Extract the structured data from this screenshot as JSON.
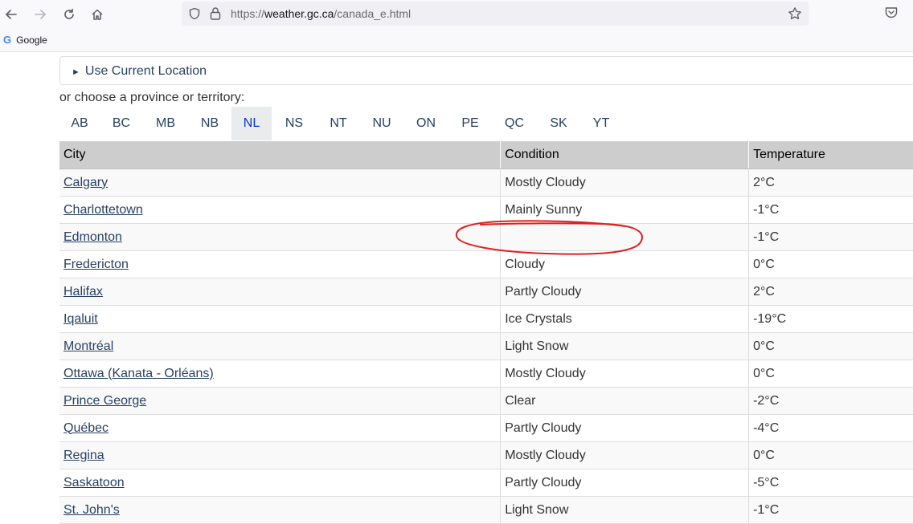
{
  "browser": {
    "url": "https://weather.gc.ca/canada_e.html",
    "url_host": "weather.gc.ca",
    "url_prefix": "https://",
    "url_path": "/canada_e.html",
    "bookmark_label": "Google",
    "bookmark_icon": "G"
  },
  "page": {
    "location_summary": "Use Current Location",
    "choose_text": "or choose a province or territory:",
    "provinces": [
      "AB",
      "BC",
      "MB",
      "NB",
      "NL",
      "NS",
      "NT",
      "NU",
      "ON",
      "PE",
      "QC",
      "SK",
      "YT"
    ],
    "active_province": "NL"
  },
  "table": {
    "headers": [
      "City",
      "Condition",
      "Temperature"
    ],
    "rows": [
      {
        "city": "Calgary",
        "condition": "Mostly Cloudy",
        "temperature": "2°C"
      },
      {
        "city": "Charlottetown",
        "condition": "Mainly Sunny",
        "temperature": "-1°C"
      },
      {
        "city": "Edmonton",
        "condition": "",
        "temperature": "-1°C"
      },
      {
        "city": "Fredericton",
        "condition": "Cloudy",
        "temperature": "0°C"
      },
      {
        "city": "Halifax",
        "condition": "Partly Cloudy",
        "temperature": "2°C"
      },
      {
        "city": "Iqaluit",
        "condition": "Ice Crystals",
        "temperature": "-19°C"
      },
      {
        "city": "Montréal",
        "condition": "Light Snow",
        "temperature": "0°C"
      },
      {
        "city": "Ottawa (Kanata - Orléans)",
        "condition": "Mostly Cloudy",
        "temperature": "0°C"
      },
      {
        "city": "Prince George",
        "condition": "Clear",
        "temperature": "-2°C"
      },
      {
        "city": "Québec",
        "condition": "Partly Cloudy",
        "temperature": "-4°C"
      },
      {
        "city": "Regina",
        "condition": "Mostly Cloudy",
        "temperature": "0°C"
      },
      {
        "city": "Saskatoon",
        "condition": "Partly Cloudy",
        "temperature": "-5°C"
      },
      {
        "city": "St. John's",
        "condition": "Light Snow",
        "temperature": "-1°C"
      }
    ]
  },
  "colors": {
    "link": "#284162",
    "active_tab": "#0535d2",
    "annotation": "#e02020"
  }
}
